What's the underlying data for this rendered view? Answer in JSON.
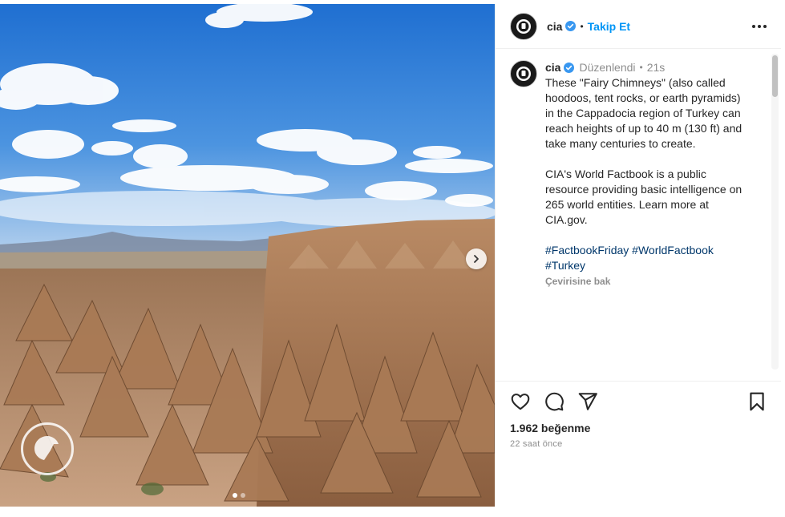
{
  "post": {
    "username": "cia",
    "follow_label": "Takip Et",
    "separator": "•",
    "edited_label": "Düzenlendi",
    "edited_sep": "•",
    "edited_time": "21s",
    "caption_p1": "These \"Fairy Chimneys\" (also called hoodoos, tent rocks, or earth pyramids) in the Cappadocia region of Turkey can reach heights of up to 40 m (130 ft) and take many centuries to create.",
    "caption_p2": "CIA's World Factbook is a public resource providing basic intelligence on 265 world entities. Learn more at CIA.gov.",
    "hashtags": [
      "#FactbookFriday",
      "#WorldFactbook",
      "#Turkey"
    ],
    "translate_label": "Çevirisine bak",
    "likes": "1.962 beğenme",
    "time_ago": "22 saat önce"
  },
  "carousel": {
    "slides": 2,
    "active": 0
  },
  "colors": {
    "accent": "#0095f6",
    "hashtag": "#00376b",
    "muted": "#8e8e8e",
    "text": "#262626"
  },
  "icons": [
    "cia-seal-icon",
    "verified-badge-icon",
    "more-options-icon",
    "heart-icon",
    "comment-icon",
    "share-icon",
    "bookmark-icon",
    "chevron-right-icon"
  ]
}
